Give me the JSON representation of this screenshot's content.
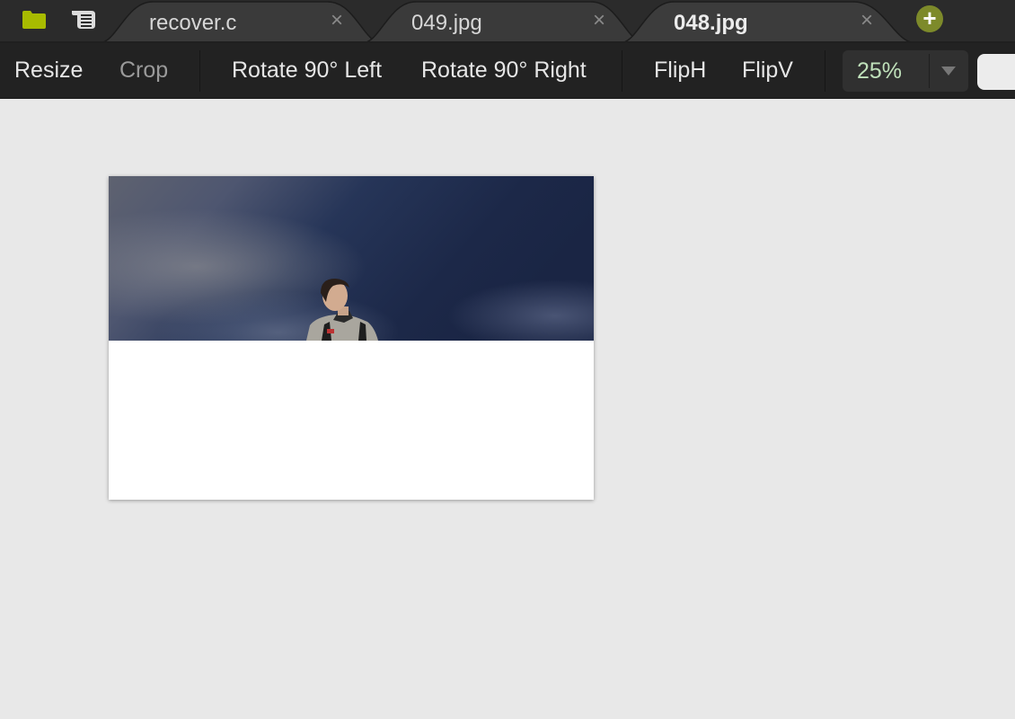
{
  "tabbar": {
    "icons": {
      "open": "folder-icon",
      "notes": "notes-icon"
    },
    "tabs": [
      {
        "label": "recover.c",
        "active": false,
        "close": "×"
      },
      {
        "label": "049.jpg",
        "active": false,
        "close": "×"
      },
      {
        "label": "048.jpg",
        "active": true,
        "close": "×"
      }
    ],
    "add_tab": "+"
  },
  "toolbar": {
    "resize": "Resize",
    "crop": "Crop",
    "rotate_left": "Rotate 90° Left",
    "rotate_right": "Rotate 90° Right",
    "flip_h": "FlipH",
    "flip_v": "FlipV",
    "zoom_level": "25%"
  },
  "colors": {
    "accent": "#7d8a2a",
    "folder": "#a8bb00",
    "zoom_text": "#bfe0ba",
    "tabbar_bg": "#2b2b2b",
    "toolbar_bg": "#222222",
    "canvas_bg": "#e8e8e8"
  },
  "canvas": {
    "image": {
      "description": "Young man in grey fleece jacket with backpack against dark blue cloudy sky; lower portion of image is blank white",
      "visible_fraction": 0.51
    }
  }
}
